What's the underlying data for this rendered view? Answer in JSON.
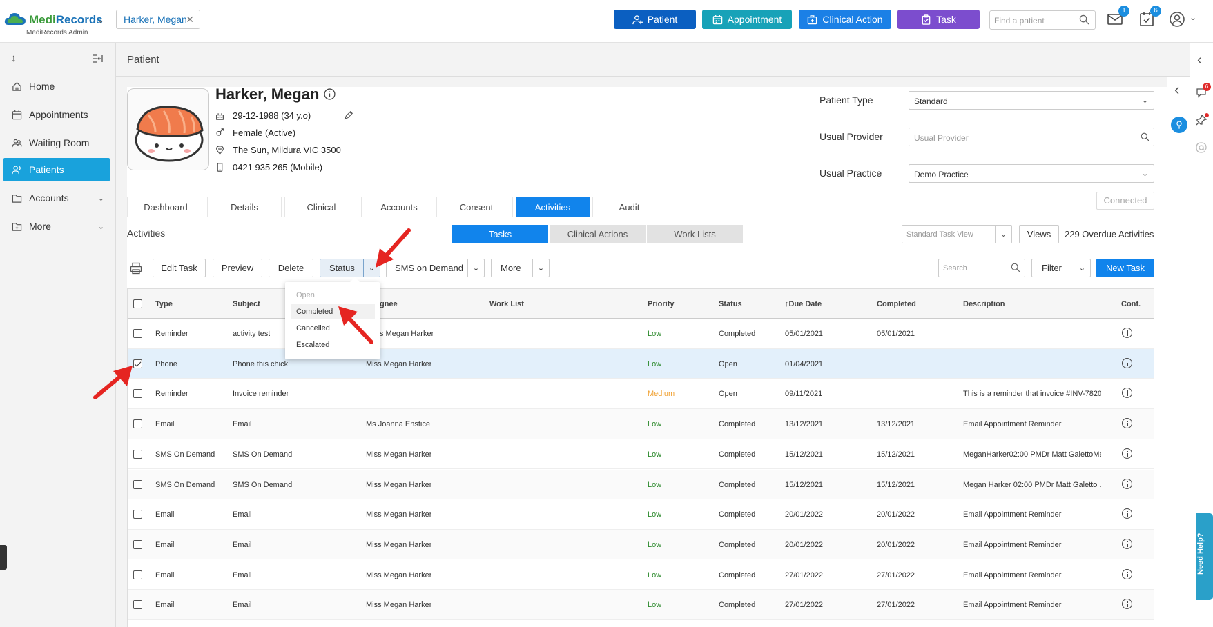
{
  "brand": {
    "name_part1": "Medi",
    "name_part2": "Records",
    "subtitle": "MediRecords Admin"
  },
  "open_patient_tab": {
    "label": "Harker, Megan"
  },
  "header_buttons": [
    {
      "label": "Patient",
      "color": "#0b5fc1"
    },
    {
      "label": "Appointment",
      "color": "#17a2b8"
    },
    {
      "label": "Clinical Action",
      "color": "#1b80e6"
    },
    {
      "label": "Task",
      "color": "#7c4dce"
    }
  ],
  "find_patient": {
    "placeholder": "Find a patient"
  },
  "notifications": {
    "mail_count": "1",
    "tasks_count": "6"
  },
  "sidebar": {
    "items": [
      {
        "label": "Home",
        "icon": "home-icon"
      },
      {
        "label": "Appointments",
        "icon": "calendar-icon"
      },
      {
        "label": "Waiting Room",
        "icon": "people-icon"
      },
      {
        "label": "Patients",
        "icon": "patient-icon",
        "active": true
      },
      {
        "label": "Accounts",
        "icon": "folder-icon"
      },
      {
        "label": "More",
        "icon": "folder-plus-icon"
      }
    ]
  },
  "page": {
    "title": "Patient"
  },
  "patient": {
    "name": "Harker, Megan",
    "dob": "29-12-1988 (34 y.o)",
    "gender": "Female (Active)",
    "address": "The Sun, Mildura VIC 3500",
    "phone": "0421 935 265 (Mobile)"
  },
  "form": {
    "patient_type_label": "Patient Type",
    "patient_type_value": "Standard",
    "usual_provider_label": "Usual Provider",
    "usual_provider_placeholder": "Usual Provider",
    "usual_practice_label": "Usual Practice",
    "usual_practice_value": "Demo Practice",
    "connected_label": "Connected"
  },
  "tabs": [
    "Dashboard",
    "Details",
    "Clinical",
    "Accounts",
    "Consent",
    "Activities",
    "Audit"
  ],
  "activities": {
    "label": "Activities",
    "segments": [
      "Tasks",
      "Clinical Actions",
      "Work Lists"
    ],
    "view_placeholder": "Standard Task View",
    "views_label": "Views",
    "overdue": "229 Overdue Activities"
  },
  "toolbar": {
    "edit": "Edit Task",
    "preview": "Preview",
    "delete": "Delete",
    "status": "Status",
    "sms": "SMS on Demand",
    "more": "More",
    "search_placeholder": "Search",
    "filter": "Filter",
    "new_task": "New Task"
  },
  "status_menu": {
    "items": [
      "Open",
      "Completed",
      "Cancelled",
      "Escalated"
    ]
  },
  "table": {
    "columns": [
      "Type",
      "Subject",
      "gnee",
      "Work List",
      "Priority",
      "Status",
      "Due Date",
      "Completed",
      "Description",
      "Conf."
    ],
    "rows": [
      {
        "type": "Reminder",
        "subject": "activity test",
        "assignee": "s Megan Harker",
        "priority": "Low",
        "status": "Completed",
        "due": "05/01/2021",
        "completed": "05/01/2021",
        "description": ""
      },
      {
        "type": "Phone",
        "subject": "Phone this chick",
        "assignee": "Miss Megan Harker",
        "priority": "Low",
        "status": "Open",
        "due": "01/04/2021",
        "completed": "",
        "description": ""
      },
      {
        "type": "Reminder",
        "subject": "Invoice reminder",
        "assignee": "",
        "priority": "Medium",
        "status": "Open",
        "due": "09/11/2021",
        "completed": "",
        "description": "This is a reminder that invoice #INV-7820 ..."
      },
      {
        "type": "Email",
        "subject": "Email",
        "assignee": "Ms Joanna Enstice",
        "priority": "Low",
        "status": "Completed",
        "due": "13/12/2021",
        "completed": "13/12/2021",
        "description": "Email Appointment Reminder"
      },
      {
        "type": "SMS On Demand",
        "subject": "SMS On Demand",
        "assignee": "Miss Megan Harker",
        "priority": "Low",
        "status": "Completed",
        "due": "15/12/2021",
        "completed": "15/12/2021",
        "description": "MeganHarker02:00 PMDr Matt GalettoMe..."
      },
      {
        "type": "SMS On Demand",
        "subject": "SMS On Demand",
        "assignee": "Miss Megan Harker",
        "priority": "Low",
        "status": "Completed",
        "due": "15/12/2021",
        "completed": "15/12/2021",
        "description": "Megan Harker 02:00 PMDr Matt Galetto ..."
      },
      {
        "type": "Email",
        "subject": "Email",
        "assignee": "Miss Megan Harker",
        "priority": "Low",
        "status": "Completed",
        "due": "20/01/2022",
        "completed": "20/01/2022",
        "description": "Email Appointment Reminder"
      },
      {
        "type": "Email",
        "subject": "Email",
        "assignee": "Miss Megan Harker",
        "priority": "Low",
        "status": "Completed",
        "due": "20/01/2022",
        "completed": "20/01/2022",
        "description": "Email Appointment Reminder"
      },
      {
        "type": "Email",
        "subject": "Email",
        "assignee": "Miss Megan Harker",
        "priority": "Low",
        "status": "Completed",
        "due": "27/01/2022",
        "completed": "27/01/2022",
        "description": "Email Appointment Reminder"
      },
      {
        "type": "Email",
        "subject": "Email",
        "assignee": "Miss Megan Harker",
        "priority": "Low",
        "status": "Completed",
        "due": "27/01/2022",
        "completed": "27/01/2022",
        "description": "Email Appointment Reminder"
      }
    ]
  },
  "right_rail": {
    "chat_badge": "6"
  },
  "help": {
    "label": "Need Help?"
  },
  "colors": {
    "primary": "#1184ec",
    "low": "#2e8b2e",
    "medium": "#f0a030",
    "annotation": "#e52521"
  }
}
